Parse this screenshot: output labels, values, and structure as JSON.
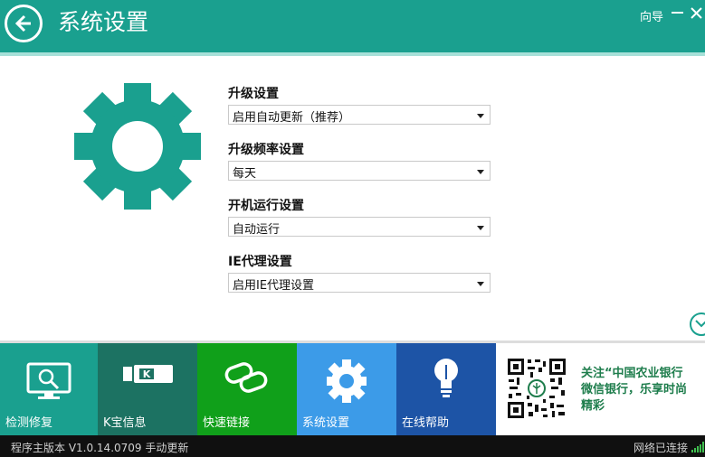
{
  "header": {
    "title": "系统设置",
    "guide_label": "向导",
    "bg_color": "#1aa08f"
  },
  "settings": [
    {
      "label": "升级设置",
      "value": "启用自动更新（推荐）"
    },
    {
      "label": "升级频率设置",
      "value": "每天"
    },
    {
      "label": "开机运行设置",
      "value": "自动运行"
    },
    {
      "label": "IE代理设置",
      "value": "启用IE代理设置"
    }
  ],
  "tiles": [
    {
      "label": "检测修复",
      "color": "#1aa08f",
      "icon": "monitor-search-icon"
    },
    {
      "label": "K宝信息",
      "color": "#1c7262",
      "icon": "usb-key-icon"
    },
    {
      "label": "快速链接",
      "color": "#10a01a",
      "icon": "link-icon"
    },
    {
      "label": "系统设置",
      "color": "#3c9be8",
      "icon": "gear-icon"
    },
    {
      "label": "在线帮助",
      "color": "#1d54a6",
      "icon": "lightbulb-icon"
    }
  ],
  "promo": {
    "text": "关注“中国农业银行\n微信银行，乐享时尚\n精彩"
  },
  "status": {
    "version_text": "程序主版本 V1.0.14.0709 手动更新",
    "network_text": "网络已连接"
  }
}
